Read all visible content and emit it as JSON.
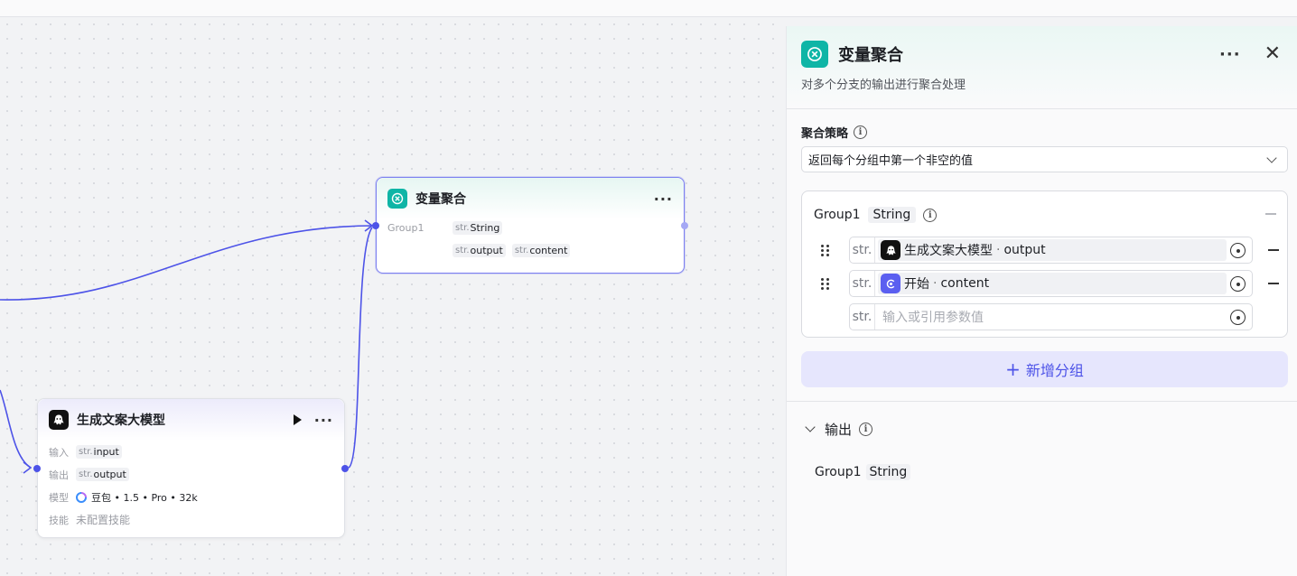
{
  "canvas": {
    "agg_node": {
      "title": "变量聚合",
      "more": "···",
      "group_label": "Group1",
      "type_prefix": "str.",
      "group_type": "String",
      "ref1": "output",
      "ref2": "content"
    },
    "llm_node": {
      "title": "生成文案大模型",
      "more": "···",
      "input_label": "输入",
      "input_value": "input",
      "output_label": "输出",
      "output_value": "output",
      "model_label": "模型",
      "model_value": "豆包 • 1.5 • Pro • 32k",
      "skill_label": "技能",
      "skill_value": "未配置技能",
      "type_prefix": "str."
    }
  },
  "panel": {
    "title": "变量聚合",
    "more": "···",
    "close": "✕",
    "description": "对多个分支的输出进行聚合处理",
    "strategy_label": "聚合策略",
    "strategy_value": "返回每个分组中第一个非空的值",
    "group": {
      "name": "Group1",
      "type": "String",
      "rows": [
        {
          "type": "str.",
          "source": "生成文案大模型",
          "var": "output"
        },
        {
          "type": "str.",
          "source": "开始",
          "var": "content"
        }
      ],
      "empty_row_type": "str.",
      "placeholder": "输入或引用参数值"
    },
    "add_group_label": "新增分组",
    "output_label": "输出",
    "output_item_name": "Group1",
    "output_item_type": "String",
    "info_glyph": "i"
  },
  "colors": {
    "accent": "#4d53e8",
    "aggregate_icon": "#0fb5a6",
    "start_icon": "#5b5ff0"
  }
}
